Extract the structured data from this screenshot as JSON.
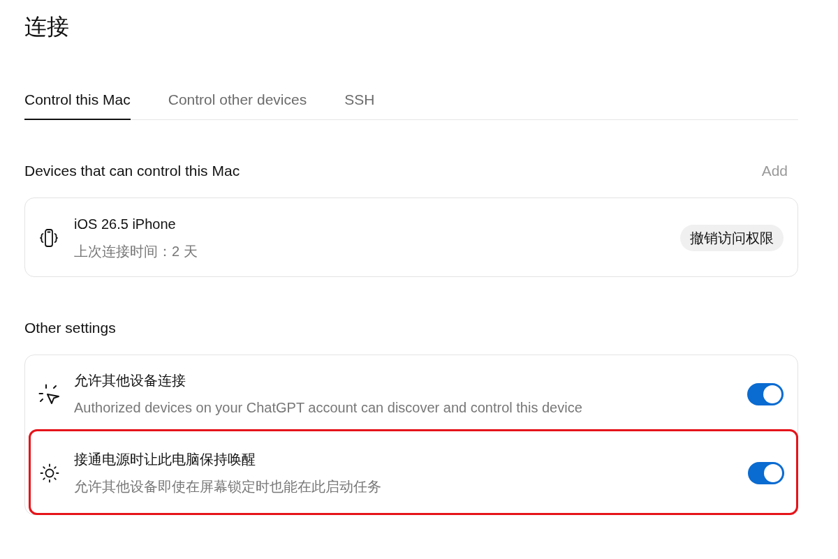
{
  "page": {
    "title": "连接"
  },
  "tabs": [
    {
      "label": "Control this Mac",
      "selected": true
    },
    {
      "label": "Control other devices",
      "selected": false
    },
    {
      "label": "SSH",
      "selected": false
    }
  ],
  "devices_section": {
    "heading": "Devices that can control this Mac",
    "add_label": "Add",
    "devices": [
      {
        "name": "iOS 26.5 iPhone",
        "last_connected": "上次连接时间：2 天",
        "revoke_label": "撤销访问权限"
      }
    ]
  },
  "other_settings": {
    "heading": "Other settings",
    "items": [
      {
        "title": "允许其他设备连接",
        "description": "Authorized devices on your ChatGPT account can discover and control this device",
        "on": true,
        "highlighted": false
      },
      {
        "title": "接通电源时让此电脑保持唤醒",
        "description": "允许其他设备即使在屏幕锁定时也能在此启动任务",
        "on": true,
        "highlighted": true
      }
    ]
  }
}
